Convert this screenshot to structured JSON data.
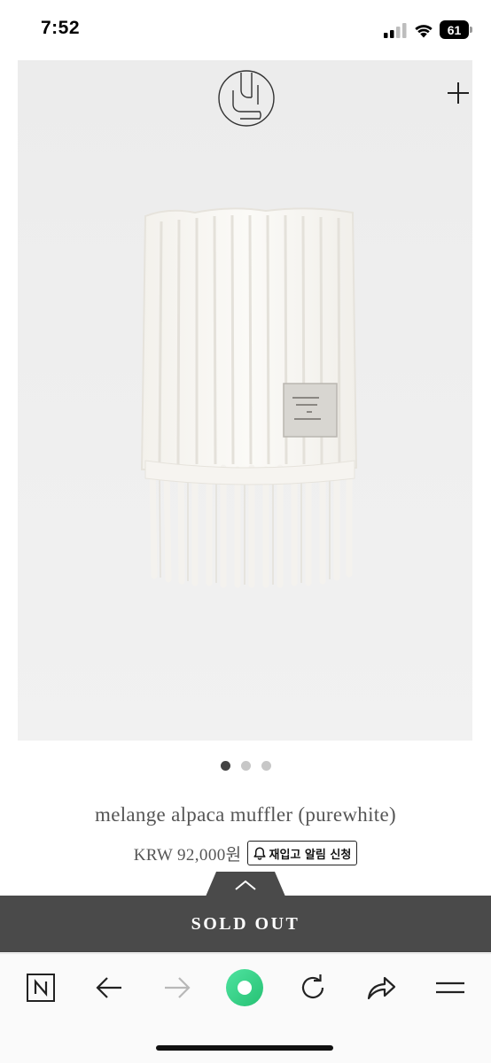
{
  "status_bar": {
    "time": "7:52",
    "battery": "61",
    "icons": [
      "signal-icon",
      "wifi-icon",
      "battery-icon"
    ]
  },
  "product": {
    "logo_icon": "brand-logo",
    "expand_icon": "plus-icon",
    "image_subject": "white knit scarf with fringe",
    "tag_text": "Handmade with love by TOWNSFAL",
    "carousel": {
      "count": 3,
      "active_index": 0
    },
    "name": "melange alpaca muffler (purewhite)",
    "price": "KRW 92,000원",
    "restock_button": {
      "icon": "bell-icon",
      "label": "재입고 알림 신청"
    }
  },
  "purchase_bar": {
    "collapse_icon": "chevron-up-icon",
    "sold_out_label": "SOLD OUT",
    "background": "#4a4a4a"
  },
  "browser_toolbar": {
    "items": [
      {
        "name": "naver-home-button",
        "icon": "naver-n-icon"
      },
      {
        "name": "back-button",
        "icon": "arrow-left-icon"
      },
      {
        "name": "forward-button",
        "icon": "arrow-right-icon",
        "disabled": true
      },
      {
        "name": "green-dot-button",
        "icon": "green-dot-icon"
      },
      {
        "name": "refresh-button",
        "icon": "refresh-icon"
      },
      {
        "name": "share-button",
        "icon": "share-icon"
      },
      {
        "name": "menu-button",
        "icon": "menu-icon"
      }
    ],
    "accent": "#3ed08a"
  }
}
